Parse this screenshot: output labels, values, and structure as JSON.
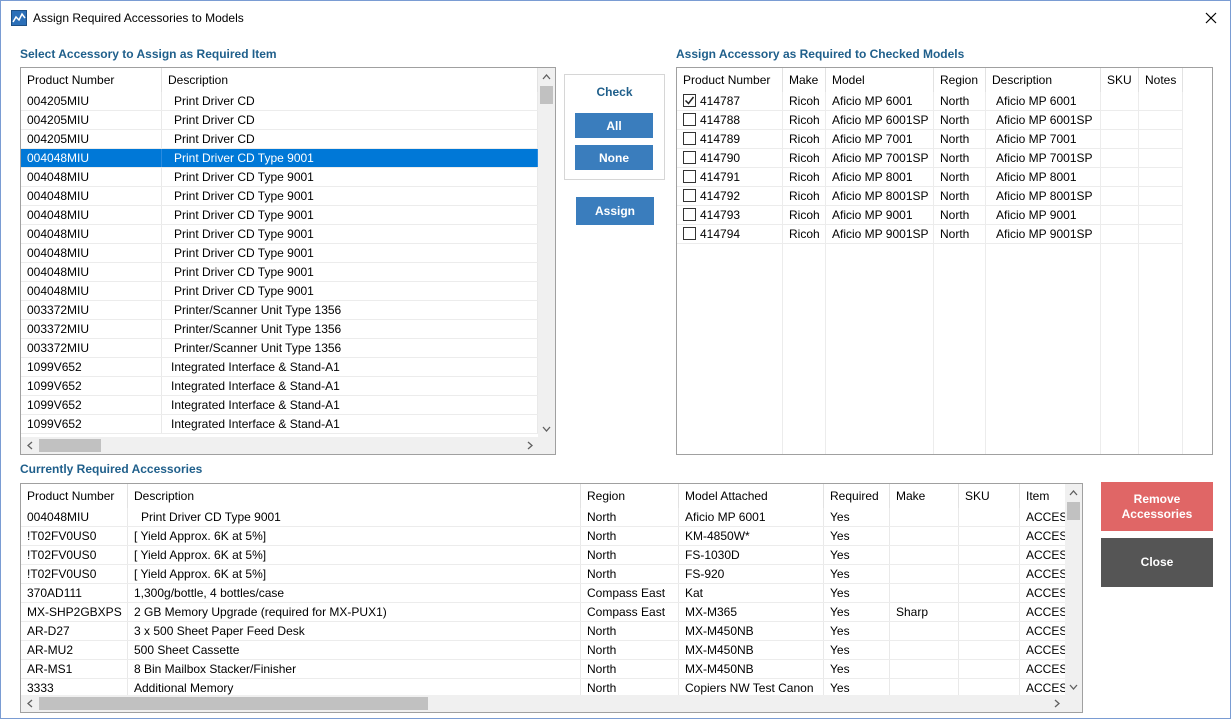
{
  "window": {
    "title": "Assign Required Accessories to Models"
  },
  "left_panel": {
    "label": "Select Accessory to Assign as Required Item",
    "columns": [
      "Product Number",
      "Description"
    ],
    "rows": [
      [
        "004205MIU",
        "Print Driver CD"
      ],
      [
        "004205MIU",
        "Print Driver CD"
      ],
      [
        "004205MIU",
        "Print Driver CD"
      ],
      [
        "004048MIU",
        "Print Driver CD Type 9001"
      ],
      [
        "004048MIU",
        "Print Driver CD Type 9001"
      ],
      [
        "004048MIU",
        "Print Driver CD Type 9001"
      ],
      [
        "004048MIU",
        "Print Driver CD Type 9001"
      ],
      [
        "004048MIU",
        "Print Driver CD Type 9001"
      ],
      [
        "004048MIU",
        "Print Driver CD Type 9001"
      ],
      [
        "004048MIU",
        "Print Driver CD Type 9001"
      ],
      [
        "004048MIU",
        "Print Driver CD Type 9001"
      ],
      [
        "003372MIU",
        "Printer/Scanner Unit Type 1356"
      ],
      [
        "003372MIU",
        "Printer/Scanner Unit Type 1356"
      ],
      [
        "003372MIU",
        "Printer/Scanner Unit Type 1356"
      ],
      [
        "1099V652",
        "Integrated Interface & Stand-A1"
      ],
      [
        "1099V652",
        "Integrated Interface & Stand-A1"
      ],
      [
        "1099V652",
        "Integrated Interface & Stand-A1"
      ],
      [
        "1099V652",
        "Integrated Interface & Stand-A1"
      ]
    ],
    "selected_row": 3
  },
  "check_panel": {
    "label": "Check",
    "all_label": "All",
    "none_label": "None"
  },
  "assign_label": "Assign",
  "right_panel": {
    "label": "Assign Accessory as Required to Checked Models",
    "columns": [
      "Product Number",
      "Make",
      "Model",
      "Region",
      "Description",
      "SKU",
      "Notes"
    ],
    "rows": [
      {
        "checked": true,
        "cells": [
          "414787",
          "Ricoh",
          "Aficio MP 6001",
          "North",
          "Aficio MP 6001",
          "",
          ""
        ]
      },
      {
        "checked": false,
        "cells": [
          "414788",
          "Ricoh",
          "Aficio MP 6001SP",
          "North",
          "Aficio MP 6001SP",
          "",
          ""
        ]
      },
      {
        "checked": false,
        "cells": [
          "414789",
          "Ricoh",
          "Aficio MP 7001",
          "North",
          "Aficio MP 7001",
          "",
          ""
        ]
      },
      {
        "checked": false,
        "cells": [
          "414790",
          "Ricoh",
          "Aficio MP 7001SP",
          "North",
          "Aficio MP 7001SP",
          "",
          ""
        ]
      },
      {
        "checked": false,
        "cells": [
          "414791",
          "Ricoh",
          "Aficio MP 8001",
          "North",
          "Aficio MP 8001",
          "",
          ""
        ]
      },
      {
        "checked": false,
        "cells": [
          "414792",
          "Ricoh",
          "Aficio MP 8001SP",
          "North",
          "Aficio MP 8001SP",
          "",
          ""
        ]
      },
      {
        "checked": false,
        "cells": [
          "414793",
          "Ricoh",
          "Aficio MP 9001",
          "North",
          "Aficio MP 9001",
          "",
          ""
        ]
      },
      {
        "checked": false,
        "cells": [
          "414794",
          "Ricoh",
          "Aficio MP 9001SP",
          "North",
          "Aficio MP 9001SP",
          "",
          ""
        ]
      }
    ]
  },
  "bottom_panel": {
    "label": "Currently Required Accessories",
    "columns": [
      "Product Number",
      "Description",
      "Region",
      "Model Attached",
      "Required",
      "Make",
      "SKU",
      "Item"
    ],
    "rows": [
      [
        "004048MIU",
        "Print Driver CD Type 9001",
        "North",
        "Aficio MP 6001",
        "Yes",
        "",
        "",
        "ACCESS"
      ],
      [
        "!T02FV0US0",
        "[ Yield Approx. 6K at 5%]",
        "North",
        "KM-4850W*",
        "Yes",
        "",
        "",
        "ACCESS"
      ],
      [
        "!T02FV0US0",
        "[ Yield Approx. 6K at 5%]",
        "North",
        "FS-1030D",
        "Yes",
        "",
        "",
        "ACCESS"
      ],
      [
        "!T02FV0US0",
        "[ Yield Approx. 6K at 5%]",
        "North",
        "FS-920",
        "Yes",
        "",
        "",
        "ACCESS"
      ],
      [
        "370AD111",
        "1,300g/bottle, 4 bottles/case",
        "Compass East",
        "Kat",
        "Yes",
        "",
        "",
        "ACCESS"
      ],
      [
        "MX-SHP2GBXPS",
        "2 GB Memory Upgrade (required for MX-PUX1)",
        "Compass East",
        "MX-M365",
        "Yes",
        "Sharp",
        "",
        "ACCESS"
      ],
      [
        "AR-D27",
        "3 x 500 Sheet Paper Feed Desk",
        "North",
        "MX-M450NB",
        "Yes",
        "",
        "",
        "ACCESS"
      ],
      [
        "AR-MU2",
        "500 Sheet Cassette",
        "North",
        "MX-M450NB",
        "Yes",
        "",
        "",
        "ACCESS"
      ],
      [
        "AR-MS1",
        "8 Bin Mailbox Stacker/Finisher",
        "North",
        "MX-M450NB",
        "Yes",
        "",
        "",
        "ACCESS"
      ],
      [
        "3333",
        "Additional Memory",
        "North",
        "Copiers NW Test Canon",
        "Yes",
        "",
        "",
        "ACCESS"
      ]
    ]
  },
  "buttons": {
    "remove_label": "Remove Accessories",
    "close_label": "Close"
  },
  "colors": {
    "section_label": "#1f5f8b",
    "blue_button": "#3a7dbd",
    "selection": "#0078d7",
    "remove_button": "#e06666",
    "close_button": "#555555"
  },
  "icons": [
    "app-icon",
    "close-icon",
    "checkmark-icon",
    "scroll-up-icon",
    "scroll-down-icon",
    "scroll-left-icon",
    "scroll-right-icon"
  ]
}
